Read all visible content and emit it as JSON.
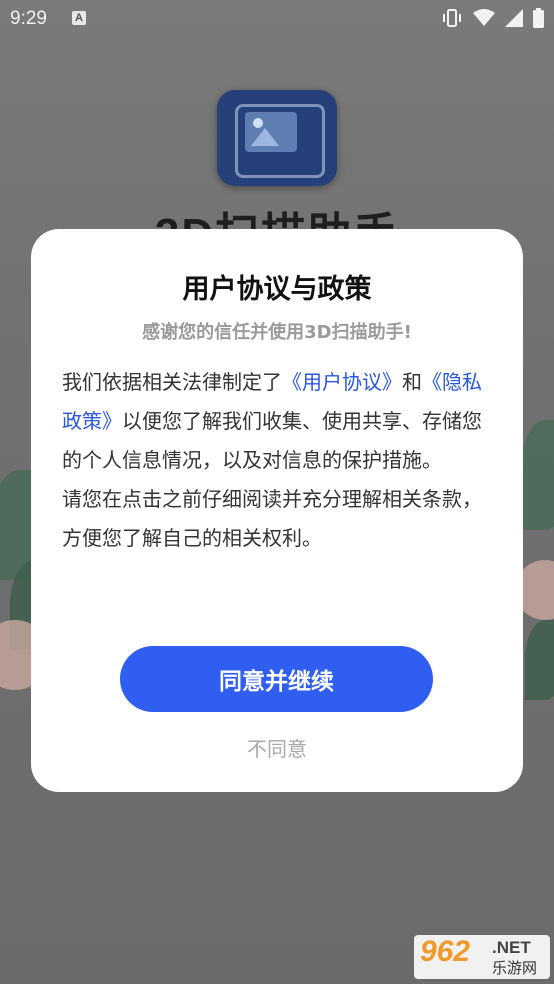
{
  "status_bar": {
    "time": "9:29",
    "notification_icon": "A",
    "icons": [
      "vibrate-icon",
      "wifi-icon",
      "signal-icon",
      "battery-icon"
    ]
  },
  "background_app": {
    "title": "3D扫描助手"
  },
  "dialog": {
    "title": "用户协议与政策",
    "subtitle": "感谢您的信任并使用3D扫描助手!",
    "body": {
      "p1_prefix": "我们依据相关法律制定了",
      "link_user_agreement": "《用户协议》",
      "p1_and": "和",
      "link_privacy_policy": "《隐私政策》",
      "p1_suffix": "以便您了解我们收集、使用共享、存储您的个人信息情况，以及对信息的保护措施。",
      "p2": "请您在点击之前仔细阅读并充分理解相关条款，方便您了解自己的相关权利。"
    },
    "agree_label": "同意并继续",
    "disagree_label": "不同意"
  },
  "watermark": {
    "main": "962",
    "net": ".NET",
    "sub": "乐游网"
  },
  "colors": {
    "accent": "#2f5ef0",
    "link": "#2a57e0",
    "overlay": "#6f6f6f"
  }
}
